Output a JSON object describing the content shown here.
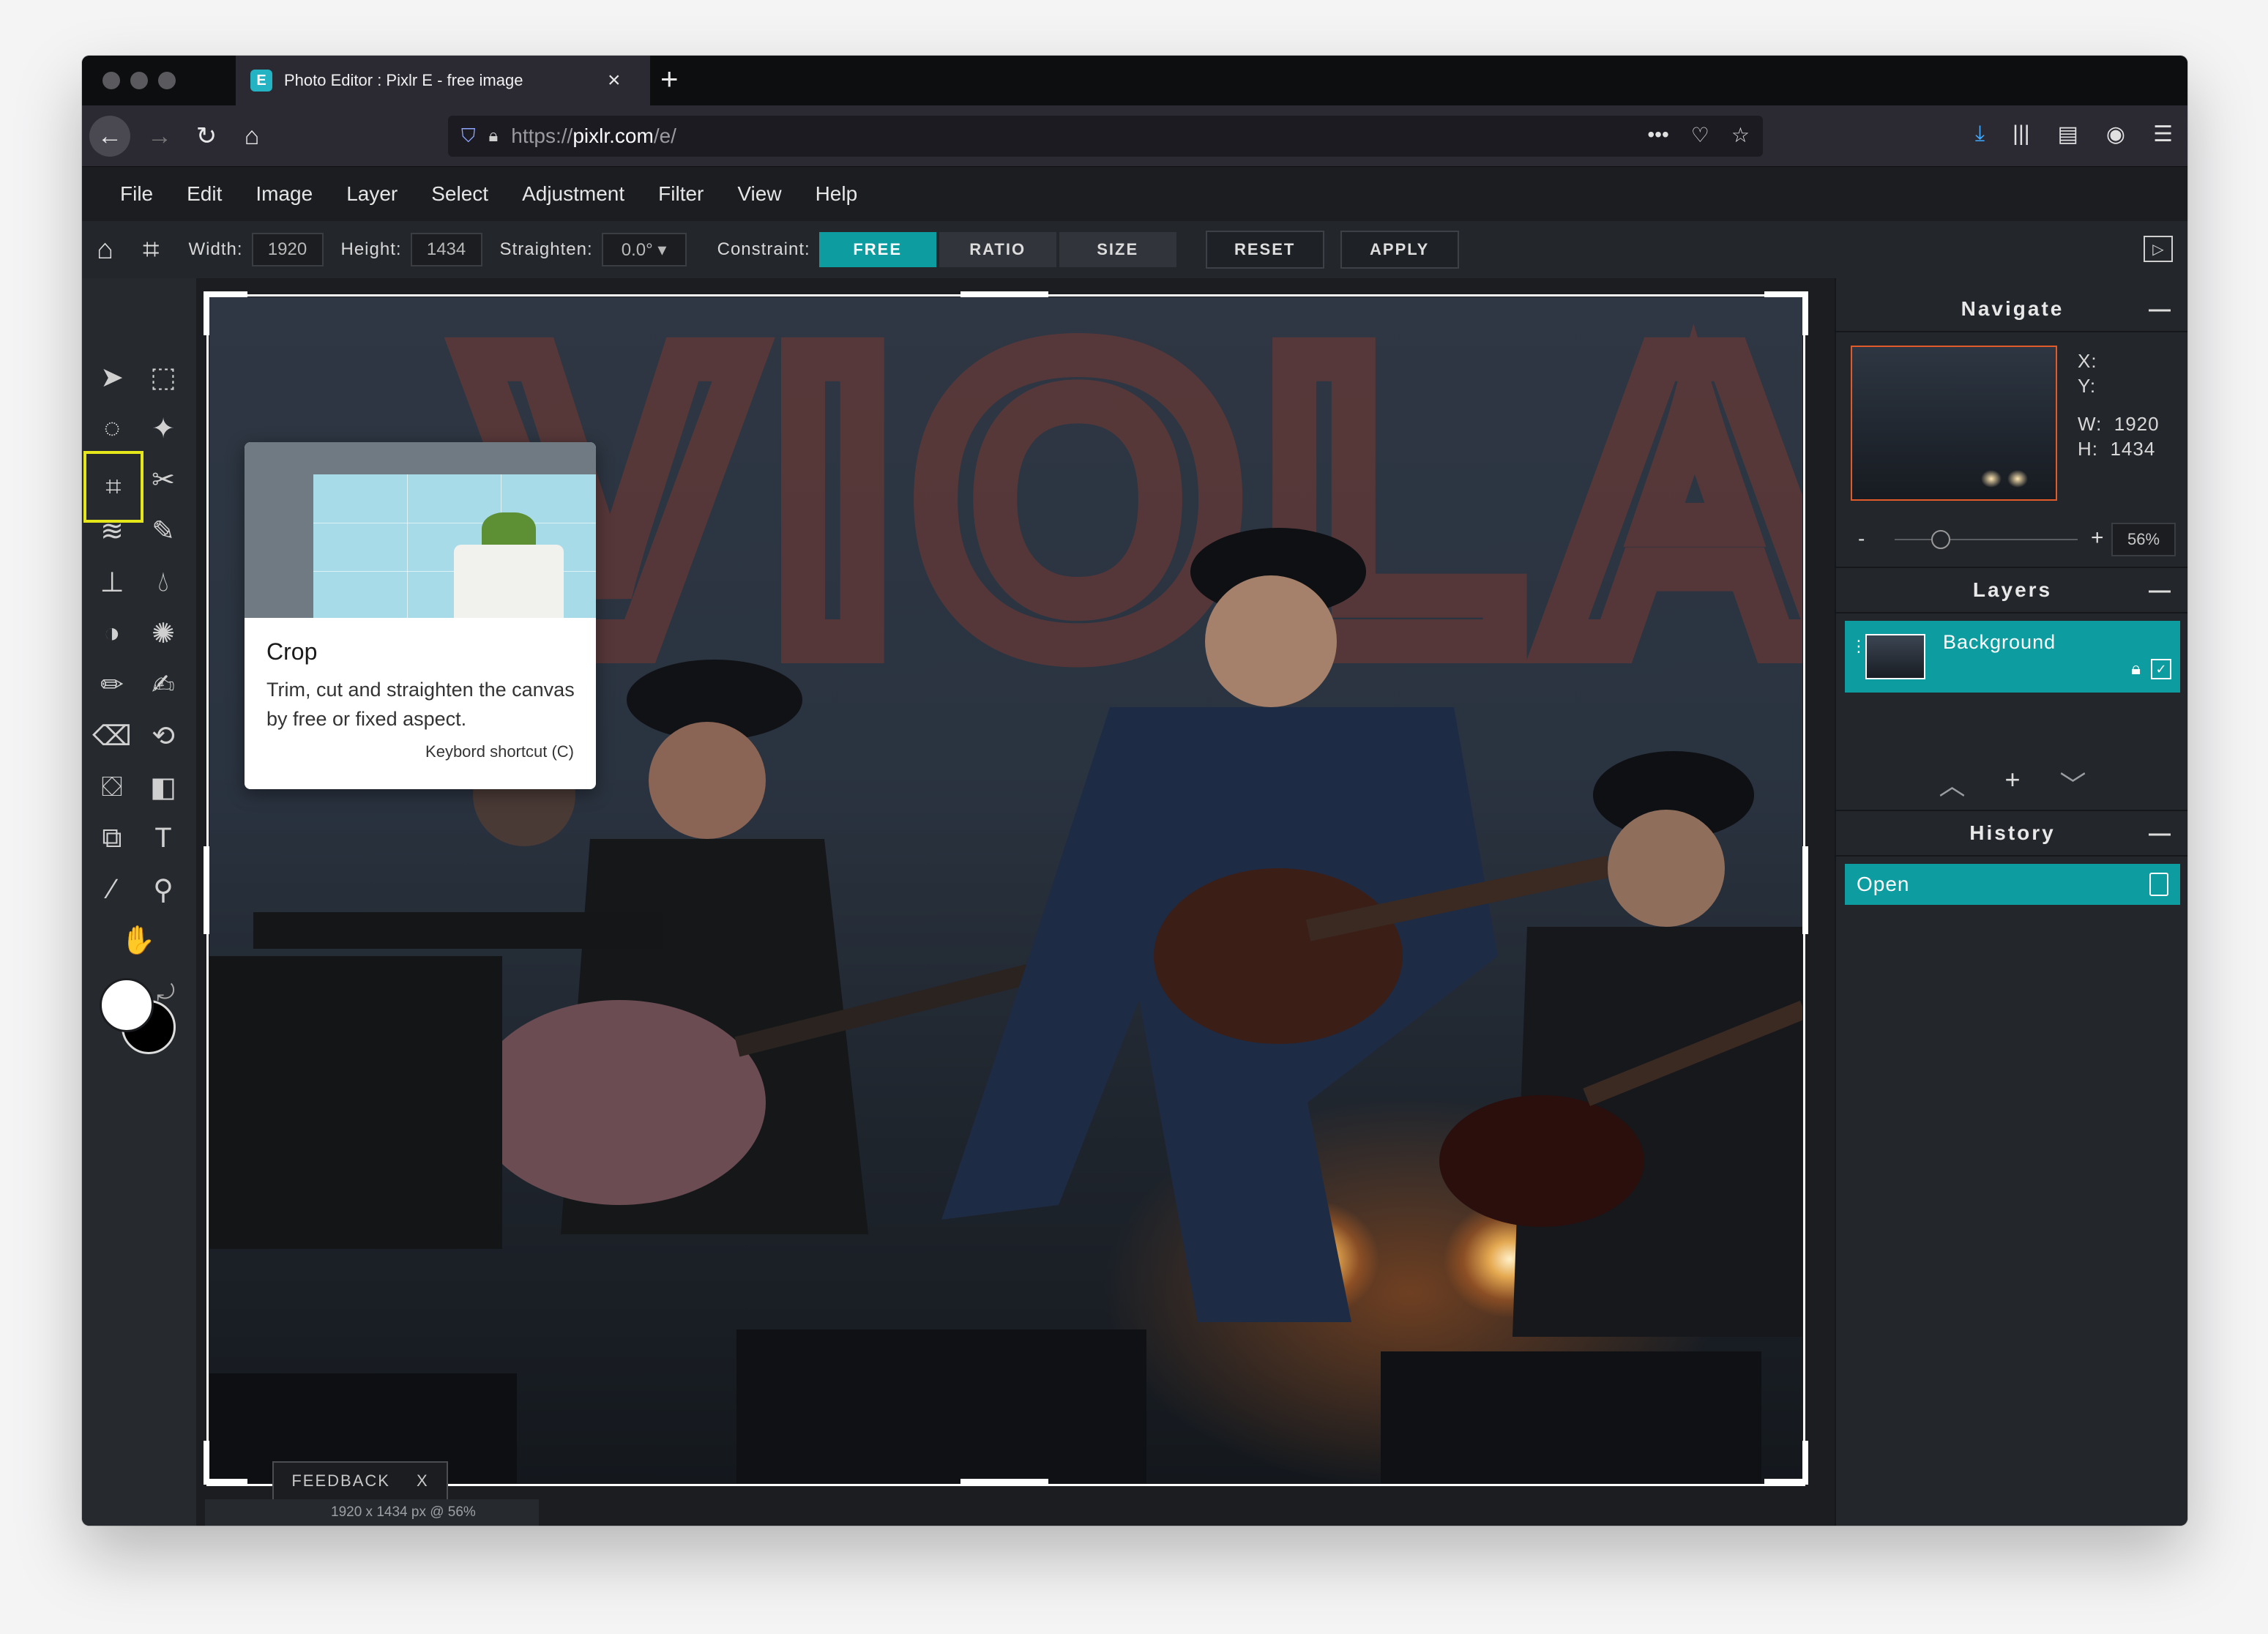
{
  "browser": {
    "tab_title": "Photo Editor : Pixlr E - free image",
    "tab_favicon": "E",
    "url_prefix": "https://",
    "url_host": "pixlr.com",
    "url_path": "/e/"
  },
  "menu": [
    "File",
    "Edit",
    "Image",
    "Layer",
    "Select",
    "Adjustment",
    "Filter",
    "View",
    "Help"
  ],
  "options": {
    "width_label": "Width:",
    "width_value": "1920",
    "height_label": "Height:",
    "height_value": "1434",
    "straighten_label": "Straighten:",
    "straighten_value": "0.0° ▾",
    "constraint_label": "Constraint:",
    "constraint_free": "FREE",
    "constraint_ratio": "RATIO",
    "constraint_size": "SIZE",
    "reset": "RESET",
    "apply": "APPLY"
  },
  "tooltip": {
    "title": "Crop",
    "description": "Trim, cut and straighten the canvas by free or fixed aspect.",
    "shortcut": "Keybord shortcut (C)"
  },
  "canvas": {
    "feedback": "FEEDBACK",
    "feedback_close": "X",
    "status": "1920 x 1434 px @ 56%"
  },
  "navigate": {
    "title": "Navigate",
    "x_label": "X:",
    "y_label": "Y:",
    "w_label": "W:",
    "w_value": "1920",
    "h_label": "H:",
    "h_value": "1434",
    "zoom_minus": "-",
    "zoom_plus": "+",
    "zoom_value": "56%",
    "zoom_level": 0.25
  },
  "layers": {
    "title": "Layers",
    "items": [
      {
        "name": "Background"
      }
    ]
  },
  "history": {
    "title": "History",
    "items": [
      {
        "name": "Open"
      }
    ]
  },
  "photo_text": "VIOLA",
  "colors": {
    "accent": "#0d9c9f",
    "tool_highlight": "#e6e71a",
    "foreground": "#ffffff",
    "background": "#000000"
  }
}
